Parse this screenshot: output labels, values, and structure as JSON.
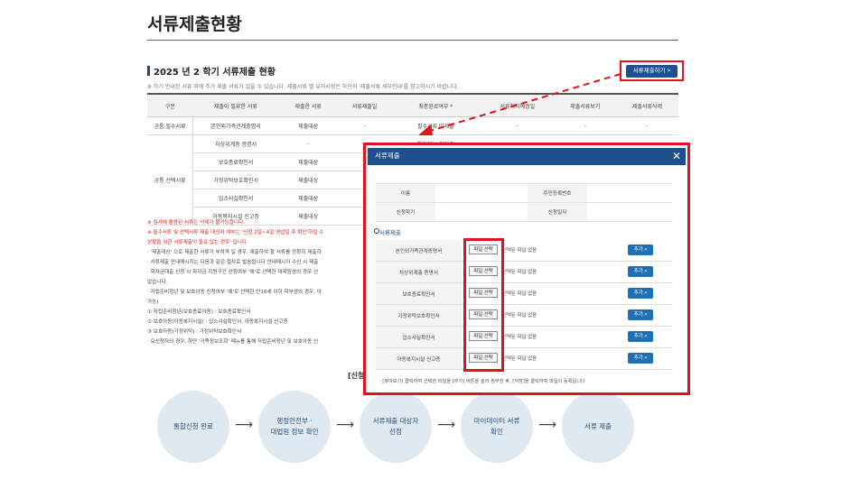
{
  "page": {
    "title": "서류제출현황"
  },
  "section": {
    "title": "2025 년 2 학기 서류제출 현황",
    "notice": "※ 하기 안내된 서류 외에 추가 제출 서류가 있을 수 있습니다. 제출서류 별 유의사항은 하단의 '제출서류 세부안내'를 참고하시기 바랍니다.",
    "submit_button": "서류제출하기 >"
  },
  "status_table": {
    "headers": [
      "구분",
      "제출이 필요한 서류",
      "제출한 서류",
      "서류제출일",
      "최종완료여부 *",
      "서류처리예정일",
      "제출서류보기",
      "제출서류삭제"
    ],
    "row_mandatory": {
      "group": "공통 필수서류",
      "doc": "본인외가족관계증명서",
      "status": "제출대상",
      "date": "-",
      "done": "필수서류 미제출",
      "expect": "-",
      "view": "-",
      "del": "-"
    },
    "group_optional": "공통 선택서류",
    "optional_rows": [
      {
        "doc": "차상위계층 증명서",
        "status": "-",
        "date": "-",
        "done": "행정정보 확인중",
        "expect": "-",
        "view": "-",
        "del": "-"
      },
      {
        "doc": "보호종료확인서",
        "status": "제출대상",
        "date": "",
        "done": "",
        "expect": "",
        "view": "",
        "del": ""
      },
      {
        "doc": "가정위탁보호확인서",
        "status": "제출대상",
        "date": "",
        "done": "",
        "expect": "",
        "view": "",
        "del": ""
      },
      {
        "doc": "입소사실확인서",
        "status": "제출대상",
        "date": "",
        "done": "",
        "expect": "",
        "view": "",
        "del": ""
      },
      {
        "doc": "아동복지시설 신고증",
        "status": "제출대상",
        "date": "",
        "done": "",
        "expect": "",
        "view": "",
        "del": ""
      }
    ]
  },
  "notes": {
    "red1": "※ 심사에 활용된 서류는 삭제가 불가능합니다.",
    "red2": "※ 필수서류 및 선택서류 제출 대상자 여부는 '신청 2일~4일 영업일 후 확인'하실 수",
    "red3": "상황을 위한 서류제출이 필요 없는 경우' 입니다.",
    "lines": [
      "· '제출대상' 으로 제출한 서류가 부적격 일 경우, 재출하여 할 서류를 정확히 제출하",
      "· 서류제출 안내메시지는 다음과 같은 절차로 발송됩니다 안내메시지 수신 시 제출",
      "· 학자금대출 신청 시 학자금 지원구간 산정여부 '예'로 선택한 대학원생의 경우 선",
      "  없습니다.",
      "· 자립준비청년 및 보호아동 신청여부 '예'로 선택한 만18세 이하 학부생의 경우, 아",
      "  가능)",
      "  ① 자립준비청년(보호종료아동) : 보호종료확인서",
      "  ② 보호아동(아동복지시설) : 입소사실확인서, 아동복지시설 신고증",
      "  ③ 보호아동(가정위탁) : 가정위탁보호확인서",
      "  · 요신청자의 경우, 하단 '가족정보조회' 메뉴를 통해 자립준비청년 및 보호아동 신"
    ]
  },
  "flow": {
    "heading": "[신청",
    "steps": [
      "통합신청 완료",
      "행정안전부 ·\n대법원 정보 확인",
      "서류제출 대상자\n선정",
      "마이데이터 서류\n확인",
      "서류 제출"
    ],
    "arrow": "⟶"
  },
  "modal": {
    "title": "서류제출",
    "close_label": "✕",
    "info": {
      "name_label": "이름",
      "name_value": "",
      "rrn_label": "주민등록번호",
      "rrn_value": "",
      "term_label": "신청학기",
      "term_value": "",
      "date_label": "신청일자",
      "date_value": ""
    },
    "section_label": "서류제출",
    "file_button": "파일 선택",
    "no_file": "선택된 파일 없음",
    "add_button": "추가 >",
    "docs": [
      "본인외가족관계증명서",
      "차상위계층 증명서",
      "보호종료확인서",
      "가정위탁보호확인서",
      "입소사실확인서",
      "아동복지시설 신고증"
    ],
    "footer": "· [찾아보기] 클릭하여 선택한 파일을 [추가] 버튼을 눌러 첨부한 후, [저장]을 클릭하여 파일이 등록됩니다"
  },
  "colors": {
    "accent": "#1d4f91",
    "highlight": "#e0141e"
  }
}
